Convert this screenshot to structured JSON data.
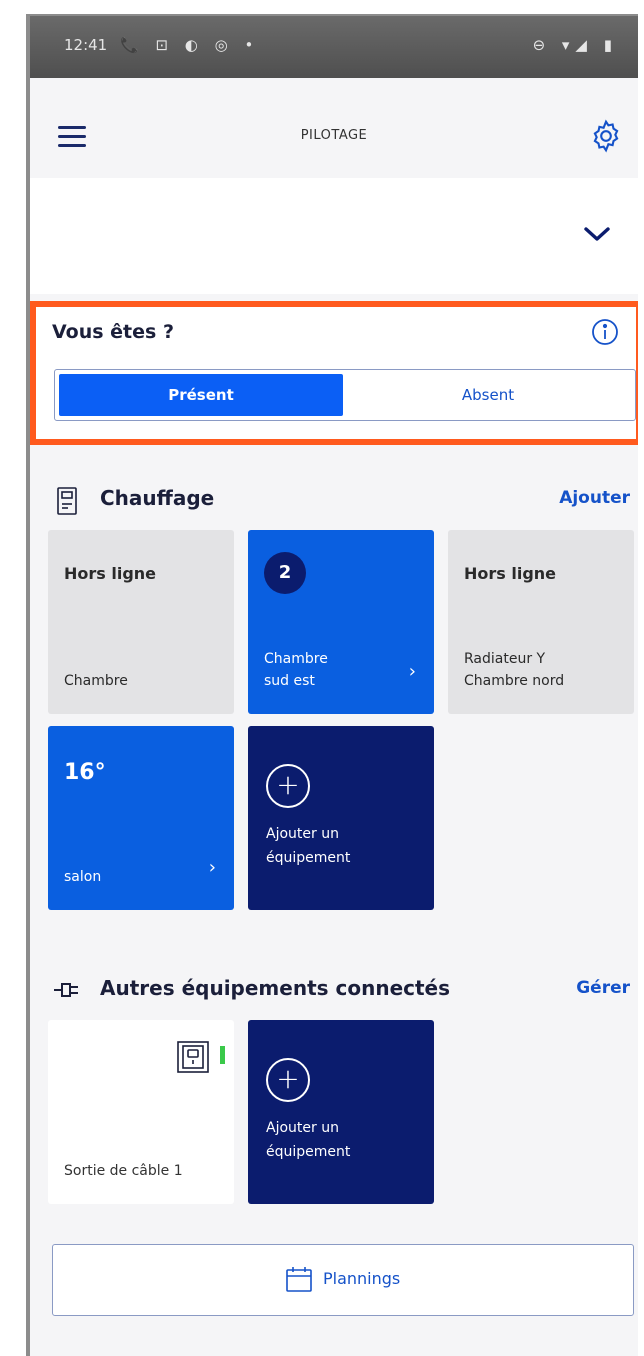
{
  "status_bar": {
    "time": "12:41",
    "left_icons": "📞 ⊡ ◐ ◎ •",
    "right_icons": "⊖ ▾◢ ▮"
  },
  "app_bar": {
    "title": "PILOTAGE"
  },
  "presence": {
    "question": "Vous êtes ?",
    "option_on": "Présent",
    "option_off": "Absent",
    "highlight_color": "#ff5a1e"
  },
  "heating": {
    "title": "Chauffage",
    "action": "Ajouter",
    "cards": [
      {
        "status": "Hors ligne",
        "name": "Chambre"
      },
      {
        "badge": "2",
        "name_line1": "Chambre",
        "name_line2": "sud est",
        "arrow": "›"
      },
      {
        "status": "Hors ligne",
        "name_line1": "Radiateur Y",
        "name_line2": "Chambre nord"
      },
      {
        "temp": "16°",
        "name": "salon",
        "arrow": "›"
      },
      {
        "add_line1": "Ajouter un",
        "add_line2": "équipement"
      }
    ]
  },
  "other": {
    "title": "Autres équipements connectés",
    "action": "Gérer",
    "cards": [
      {
        "name": "Sortie de câble 1"
      },
      {
        "add_line1": "Ajouter un",
        "add_line2": "équipement"
      }
    ]
  },
  "plannings": {
    "label": "Plannings"
  },
  "colors": {
    "primary_blue": "#0a5fe0",
    "navy": "#0b1c6e",
    "link_blue": "#1552c9"
  }
}
